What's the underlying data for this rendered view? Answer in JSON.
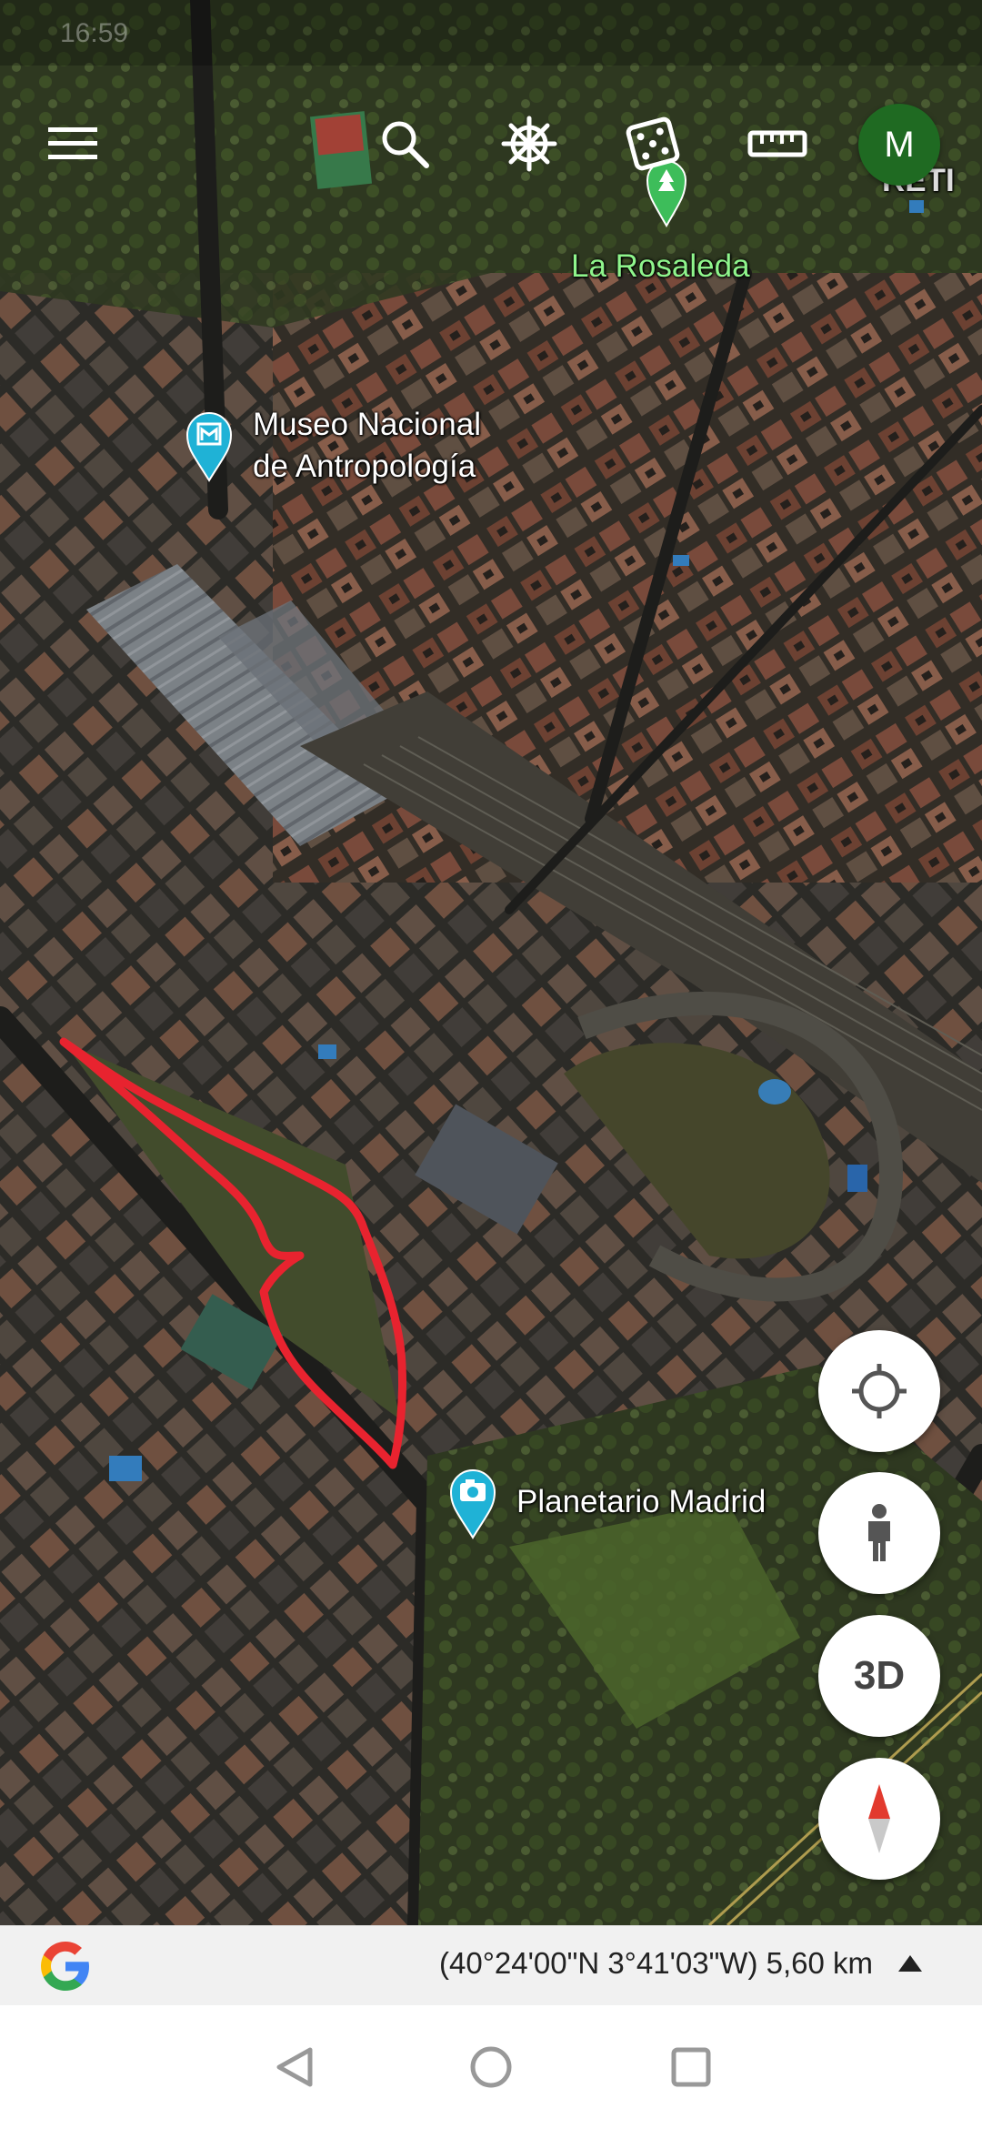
{
  "status_bar": {
    "time": "16:59"
  },
  "toolbar": {
    "menu_icon": "hamburger-menu-icon",
    "search_icon": "search-icon",
    "voyager_icon": "ship-wheel-icon",
    "feeling_lucky_icon": "dice-icon",
    "measure_icon": "ruler-icon",
    "avatar_letter": "M",
    "avatar_color": "#1f6a22"
  },
  "map": {
    "places": [
      {
        "id": "la-rosaleda",
        "name": "La Rosaleda",
        "icon": "green-park-pin-icon"
      },
      {
        "id": "museo",
        "name_line1": "Museo Nacional",
        "name_line2": "de Antropología",
        "icon": "museum-pin-icon"
      },
      {
        "id": "planetario",
        "name": "Planetario Madrid",
        "icon": "camera-pin-icon"
      }
    ],
    "partial_label": "RETI",
    "drawn_outline_color": "#e8232f"
  },
  "fabs": {
    "my_location_icon": "crosshair-icon",
    "street_view_icon": "pegman-icon",
    "toggle_3d_label": "3D",
    "compass_icon": "compass-icon"
  },
  "info_bar": {
    "logo": "google-g-logo",
    "coordinates": "(40°24'00\"N 3°41'03\"W) 5,60 km",
    "expand_icon": "caret-up-icon"
  },
  "nav_bar": {
    "back_icon": "back-triangle-icon",
    "home_icon": "home-circle-icon",
    "recents_icon": "recents-square-icon"
  }
}
